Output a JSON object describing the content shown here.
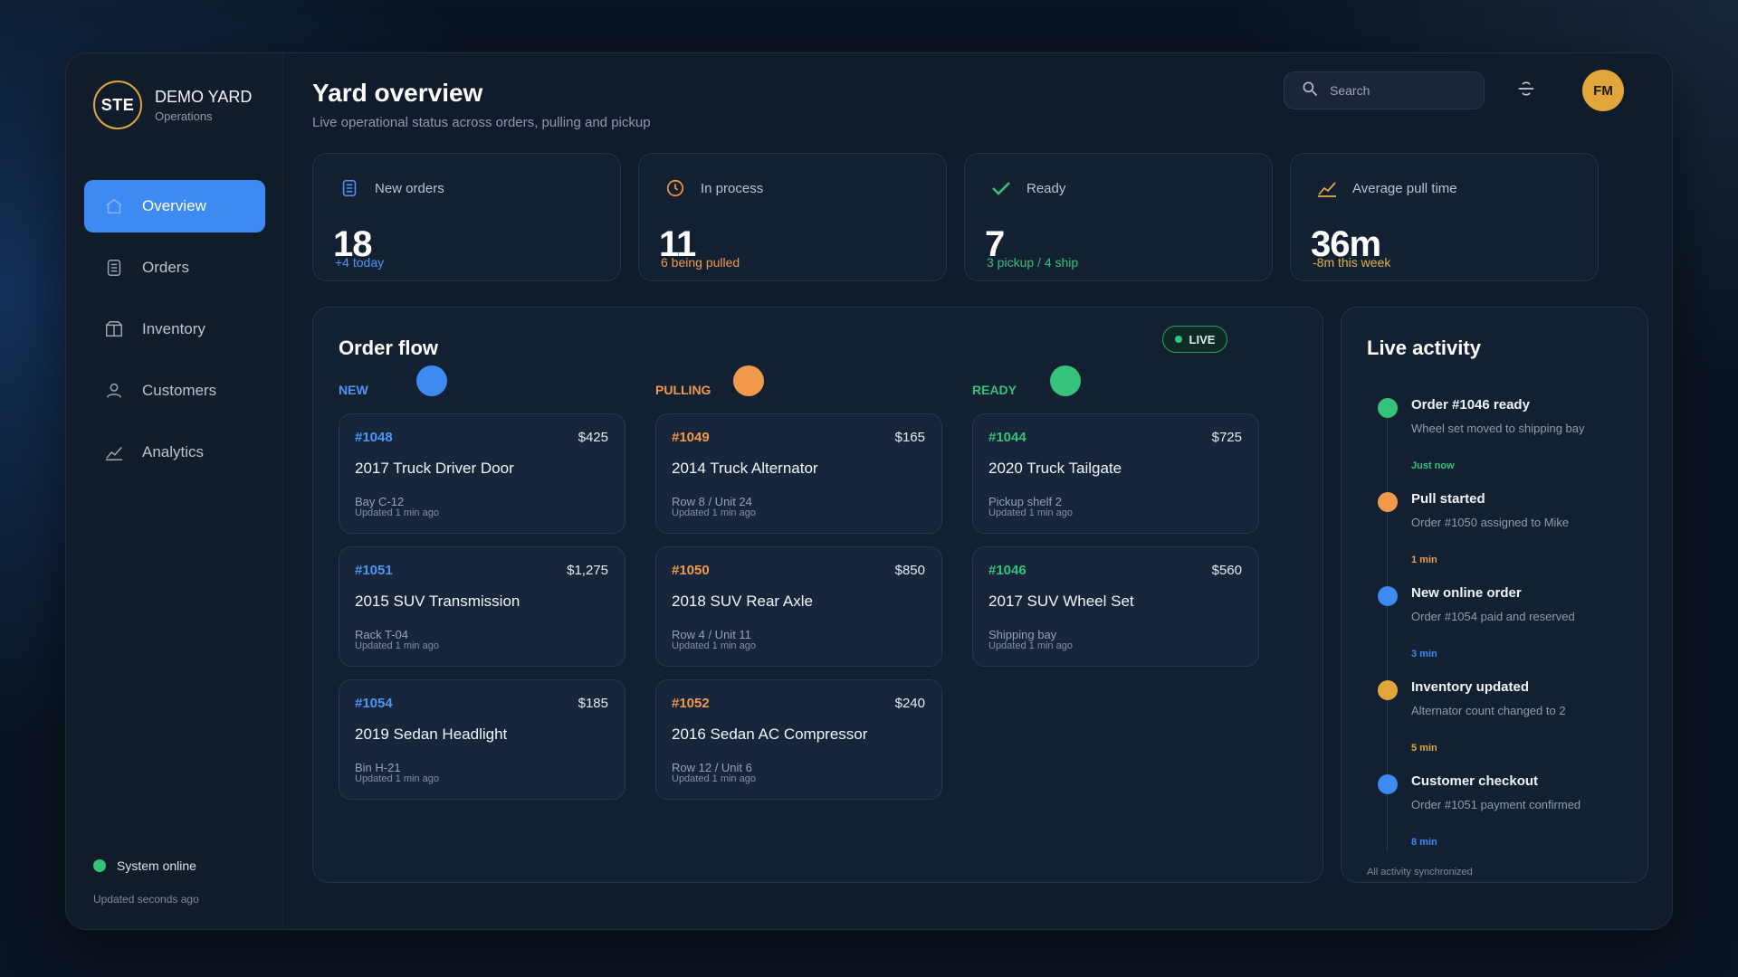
{
  "brand": {
    "logo": "STE",
    "name": "DEMO YARD",
    "sub": "Operations"
  },
  "nav": [
    {
      "label": "Overview",
      "icon": "home-icon",
      "active": true
    },
    {
      "label": "Orders",
      "icon": "document-icon"
    },
    {
      "label": "Inventory",
      "icon": "box-icon"
    },
    {
      "label": "Customers",
      "icon": "user-icon"
    },
    {
      "label": "Analytics",
      "icon": "chart-line-icon"
    }
  ],
  "system": {
    "status": "System online",
    "updated": "Updated seconds ago",
    "color": "#35c27a"
  },
  "header": {
    "title": "Yard overview",
    "subtitle": "Live operational status across orders, pulling and pickup"
  },
  "search": {
    "placeholder": "Search"
  },
  "avatar": {
    "initials": "FM"
  },
  "stats": [
    {
      "label": "New orders",
      "value": "18",
      "note": "+4 today",
      "note_color": "#4e96f5",
      "icon": "document-icon"
    },
    {
      "label": "In process",
      "value": "11",
      "note": "6 being pulled",
      "note_color": "#f19a4b",
      "icon": "clock-icon"
    },
    {
      "label": "Ready",
      "value": "7",
      "note": "3 pickup / 4 ship",
      "note_color": "#35c27a",
      "icon": "checkmark-icon"
    },
    {
      "label": "Average pull time",
      "value": "36m",
      "note": "-8m this week",
      "note_color": "#e3b24a",
      "icon": "chart-line-icon"
    }
  ],
  "flow": {
    "title": "Order flow",
    "live": "LIVE",
    "columns": [
      {
        "label": "NEW",
        "color": "#3d8bf2"
      },
      {
        "label": "PULLING",
        "color": "#f19a4b"
      },
      {
        "label": "READY",
        "color": "#35c27a"
      }
    ],
    "cards": [
      [
        {
          "id": "#1048",
          "price": "$425",
          "title": "2017 Truck Driver Door",
          "loc": "Bay C-12",
          "updated": "Updated 1 min ago"
        },
        {
          "id": "#1051",
          "price": "$1,275",
          "title": "2015 SUV Transmission",
          "loc": "Rack T-04",
          "updated": "Updated 1 min ago"
        },
        {
          "id": "#1054",
          "price": "$185",
          "title": "2019 Sedan Headlight",
          "loc": "Bin H-21",
          "updated": "Updated 1 min ago"
        }
      ],
      [
        {
          "id": "#1049",
          "price": "$165",
          "title": "2014 Truck Alternator",
          "loc": "Row 8 / Unit 24",
          "updated": "Updated 1 min ago"
        },
        {
          "id": "#1050",
          "price": "$850",
          "title": "2018 SUV Rear Axle",
          "loc": "Row 4 / Unit 11",
          "updated": "Updated 1 min ago"
        },
        {
          "id": "#1052",
          "price": "$240",
          "title": "2016 Sedan AC Compressor",
          "loc": "Row 12 / Unit 6",
          "updated": "Updated 1 min ago"
        }
      ],
      [
        {
          "id": "#1044",
          "price": "$725",
          "title": "2020 Truck Tailgate",
          "loc": "Pickup shelf 2",
          "updated": "Updated 1 min ago"
        },
        {
          "id": "#1046",
          "price": "$560",
          "title": "2017 SUV Wheel Set",
          "loc": "Shipping bay",
          "updated": "Updated 1 min ago"
        }
      ]
    ]
  },
  "activity": {
    "title": "Live activity",
    "items": [
      {
        "name": "Order #1046 ready",
        "desc": "Wheel set moved to shipping bay",
        "time": "Just now",
        "color": "#35c27a"
      },
      {
        "name": "Pull started",
        "desc": "Order #1050 assigned to Mike",
        "time": "1 min",
        "color": "#f19a4b"
      },
      {
        "name": "New online order",
        "desc": "Order #1054 paid and reserved",
        "time": "3 min",
        "color": "#3d8bf2"
      },
      {
        "name": "Inventory updated",
        "desc": "Alternator count changed to 2",
        "time": "5 min",
        "color": "#e3a63b"
      },
      {
        "name": "Customer checkout",
        "desc": "Order #1051 payment confirmed",
        "time": "8 min",
        "color": "#3d8bf2"
      }
    ],
    "footer": "All activity synchronized"
  }
}
